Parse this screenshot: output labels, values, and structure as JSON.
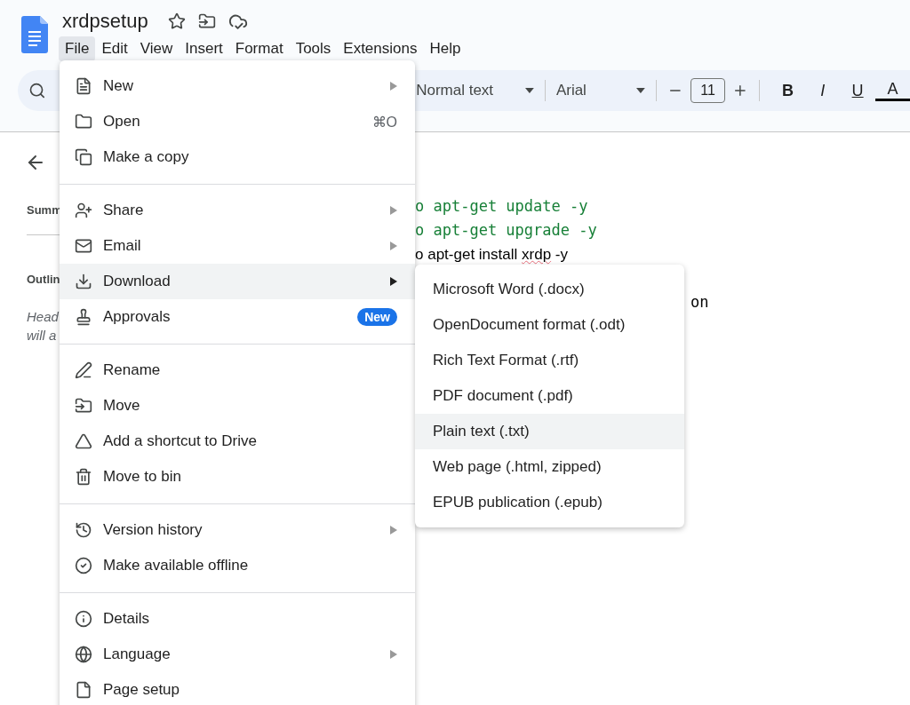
{
  "app": {
    "title": "xrdpsetup"
  },
  "menu_bar": [
    {
      "label": "File",
      "selected": true
    },
    {
      "label": "Edit",
      "selected": false
    },
    {
      "label": "View",
      "selected": false
    },
    {
      "label": "Insert",
      "selected": false
    },
    {
      "label": "Format",
      "selected": false
    },
    {
      "label": "Tools",
      "selected": false
    },
    {
      "label": "Extensions",
      "selected": false
    },
    {
      "label": "Help",
      "selected": false
    }
  ],
  "toolbar": {
    "style": "Normal text",
    "font": "Arial",
    "font_size": "11",
    "format_buttons": [
      {
        "label": "B",
        "kind": "bold"
      },
      {
        "label": "I",
        "kind": "italic"
      },
      {
        "label": "U",
        "kind": "underline"
      },
      {
        "label": "A",
        "kind": "color"
      }
    ]
  },
  "sidebar": {
    "summary": "Summ",
    "outline": "Outlin",
    "hint_lines": [
      "Head",
      "will a"
    ]
  },
  "document": {
    "lines": [
      {
        "kind": "code",
        "parts": [
          {
            "text": "o apt-get update -y",
            "misspelled": false
          }
        ]
      },
      {
        "kind": "code",
        "parts": [
          {
            "text": "o apt-get upgrade -y",
            "misspelled": false
          }
        ]
      },
      {
        "kind": "plain",
        "parts": [
          {
            "text": "o apt-get install ",
            "misspelled": false
          },
          {
            "text": "xrdp",
            "misspelled": true
          },
          {
            "text": " -y",
            "misspelled": false
          }
        ]
      },
      {
        "kind": "tail",
        "parts": [
          {
            "text": "on",
            "misspelled": false
          }
        ]
      }
    ]
  },
  "file_menu": {
    "groups": [
      [
        {
          "label": "New",
          "submenu": true,
          "selected": false
        },
        {
          "label": "Open",
          "shortcut": "⌘O",
          "submenu": false,
          "selected": false
        },
        {
          "label": "Make a copy",
          "submenu": false,
          "selected": false
        }
      ],
      [
        {
          "label": "Share",
          "submenu": true,
          "selected": false
        },
        {
          "label": "Email",
          "submenu": true,
          "selected": false
        },
        {
          "label": "Download",
          "submenu": true,
          "selected": true
        },
        {
          "label": "Approvals",
          "badge": "New",
          "submenu": false,
          "selected": false
        }
      ],
      [
        {
          "label": "Rename",
          "submenu": false,
          "selected": false
        },
        {
          "label": "Move",
          "submenu": false,
          "selected": false
        },
        {
          "label": "Add a shortcut to Drive",
          "submenu": false,
          "selected": false
        },
        {
          "label": "Move to bin",
          "submenu": false,
          "selected": false
        }
      ],
      [
        {
          "label": "Version history",
          "submenu": true,
          "selected": false
        },
        {
          "label": "Make available offline",
          "submenu": false,
          "selected": false
        }
      ],
      [
        {
          "label": "Details",
          "submenu": false,
          "selected": false
        },
        {
          "label": "Language",
          "submenu": true,
          "selected": false
        },
        {
          "label": "Page setup",
          "submenu": false,
          "selected": false
        }
      ]
    ]
  },
  "download_submenu": [
    {
      "label": "Microsoft Word (.docx)",
      "selected": false
    },
    {
      "label": "OpenDocument format (.odt)",
      "selected": false
    },
    {
      "label": "Rich Text Format (.rtf)",
      "selected": false
    },
    {
      "label": "PDF document (.pdf)",
      "selected": false
    },
    {
      "label": "Plain text (.txt)",
      "selected": true
    },
    {
      "label": "Web page (.html, zipped)",
      "selected": false
    },
    {
      "label": "EPUB publication (.epub)",
      "selected": false
    }
  ]
}
